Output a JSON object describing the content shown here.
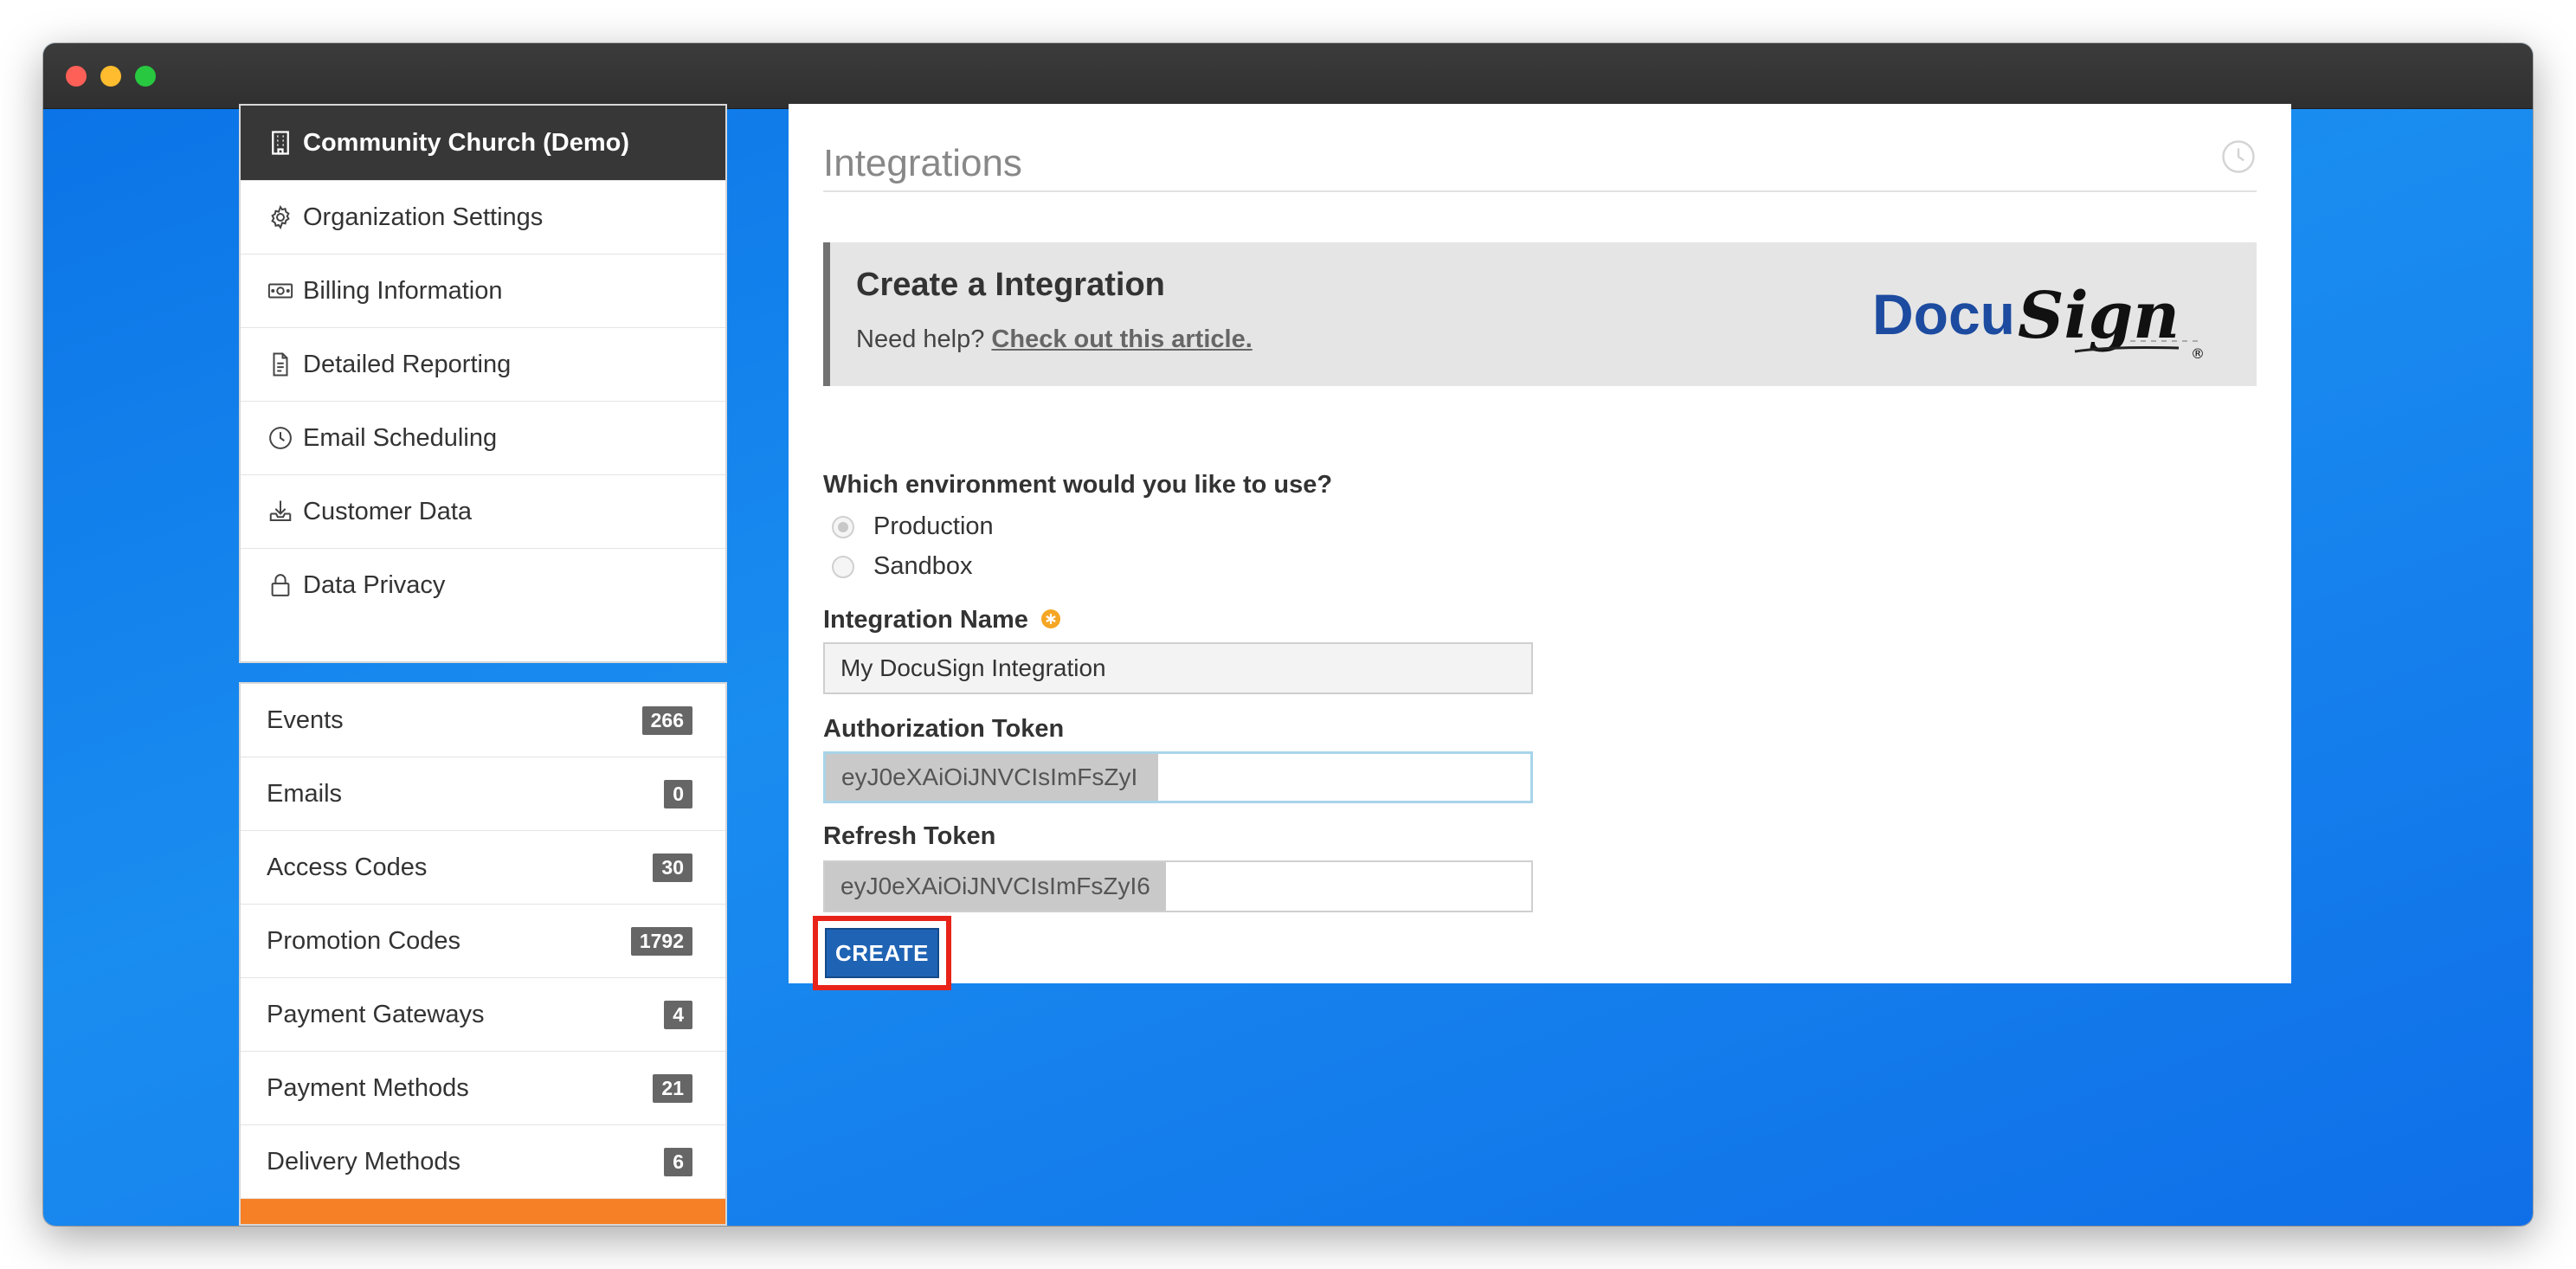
{
  "organization": {
    "name": "Community Church (Demo)",
    "items": [
      {
        "label": "Organization Settings",
        "icon": "gear-icon"
      },
      {
        "label": "Billing Information",
        "icon": "money-icon"
      },
      {
        "label": "Detailed Reporting",
        "icon": "document-icon"
      },
      {
        "label": "Email Scheduling",
        "icon": "clock-icon"
      },
      {
        "label": "Customer Data",
        "icon": "download-icon"
      },
      {
        "label": "Data Privacy",
        "icon": "lock-icon"
      }
    ]
  },
  "menu": {
    "items": [
      {
        "label": "Events",
        "count": "266"
      },
      {
        "label": "Emails",
        "count": "0"
      },
      {
        "label": "Access Codes",
        "count": "30"
      },
      {
        "label": "Promotion Codes",
        "count": "1792"
      },
      {
        "label": "Payment Gateways",
        "count": "4"
      },
      {
        "label": "Payment Methods",
        "count": "21"
      },
      {
        "label": "Delivery Methods",
        "count": "6"
      }
    ],
    "active_color": "#f58025"
  },
  "main": {
    "title": "Integrations",
    "banner": {
      "title": "Create a Integration",
      "help_prefix": "Need help?",
      "help_link": "Check out this article.",
      "logo_text_left": "Docu",
      "logo_text_right": "Sign",
      "logo_mark": "®"
    },
    "environment": {
      "label": "Which environment would you like to use?",
      "options": [
        "Production",
        "Sandbox"
      ],
      "selected": "Production"
    },
    "integration_name": {
      "label": "Integration Name",
      "value": "My DocuSign Integration"
    },
    "authorization_token": {
      "label": "Authorization Token",
      "value": "eyJ0eXAiOiJNVCIsImFsZyI"
    },
    "refresh_token": {
      "label": "Refresh Token",
      "value": "eyJ0eXAiOiJNVCIsImFsZyI6"
    },
    "create_label": "CREATE"
  },
  "colors": {
    "brand_blue": "#1f63b4",
    "highlight_red": "#e8231a",
    "sidebar_header": "#373737"
  }
}
